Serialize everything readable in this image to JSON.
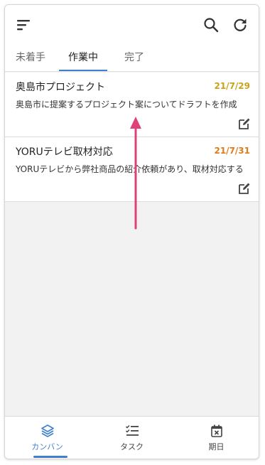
{
  "tabs": [
    {
      "label": "未着手"
    },
    {
      "label": "作業中"
    },
    {
      "label": "完了"
    }
  ],
  "active_tab": "作業中",
  "cards": [
    {
      "title": "奥島市プロジェクト",
      "date": "21/7/29",
      "date_color": "#c9a21a",
      "description": "奥島市に提案するプロジェクト案についてドラフトを作成"
    },
    {
      "title": "YORUテレビ取材対応",
      "date": "21/7/31",
      "date_color": "#e07b1a",
      "description": "YORUテレビから弊社商品の紹介依頼があり、取材対応する"
    }
  ],
  "bottom_nav": [
    {
      "label": "カンバン",
      "icon": "layers-icon"
    },
    {
      "label": "タスク",
      "icon": "checklist-icon"
    },
    {
      "label": "期日",
      "icon": "calendar-x-icon"
    }
  ],
  "active_nav": "カンバン",
  "colors": {
    "accent": "#3f7fcf",
    "annotation_arrow": "#e0407a"
  }
}
